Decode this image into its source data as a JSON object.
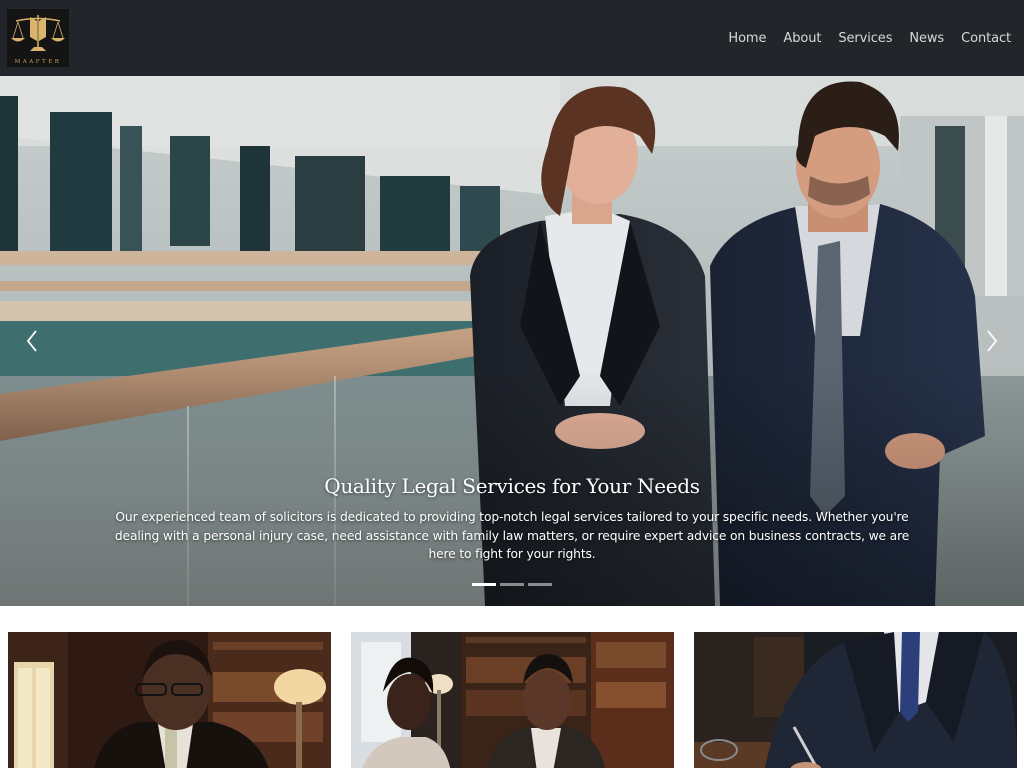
{
  "brand": {
    "logo_text": "MAAFTER",
    "logo_icon": "scales-of-justice-icon",
    "accent_color": "#c9a25a"
  },
  "nav": {
    "items": [
      {
        "label": "Home"
      },
      {
        "label": "About"
      },
      {
        "label": "Services"
      },
      {
        "label": "News"
      },
      {
        "label": "Contact"
      }
    ]
  },
  "hero": {
    "title": "Quality Legal Services for Your Needs",
    "description": "Our experienced team of solicitors is dedicated to providing top-notch legal services tailored to your specific needs. Whether you're dealing with a personal injury case, need assistance with family law matters, or require expert advice on business contracts, we are here to fight for your rights.",
    "prev_icon": "chevron-left-icon",
    "next_icon": "chevron-right-icon",
    "slide_count": 3,
    "active_slide": 1
  },
  "cards": [
    {
      "image": "lawyer-reading-in-library"
    },
    {
      "image": "lawyers-meeting-in-office"
    },
    {
      "image": "lawyer-signing-document"
    }
  ],
  "colors": {
    "header_bg": "#22252a",
    "nav_text": "#d8d8d8"
  }
}
